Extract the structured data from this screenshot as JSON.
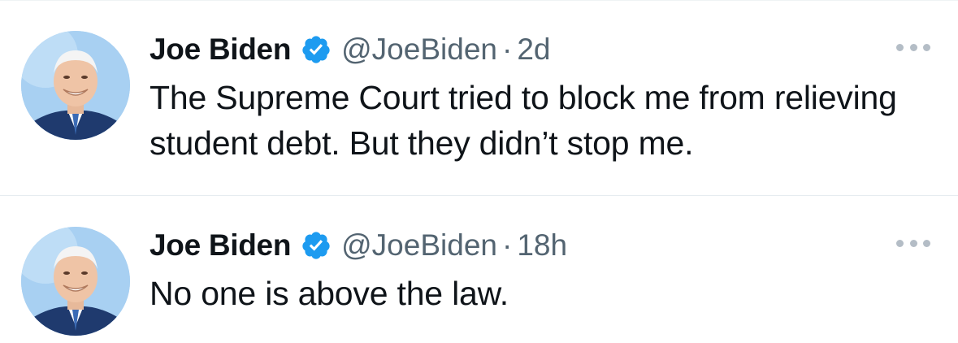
{
  "tweets": [
    {
      "author_name": "Joe Biden",
      "verified_icon": "verified-badge-icon",
      "handle": "@JoeBiden",
      "separator": "·",
      "time": "2d",
      "text": "The Supreme Court tried to block me from relieving student debt. But they didn’t stop me.",
      "more_icon": "more-options-icon"
    },
    {
      "author_name": "Joe Biden",
      "verified_icon": "verified-badge-icon",
      "handle": "@JoeBiden",
      "separator": "·",
      "time": "18h",
      "text": "No one is above the law.",
      "more_icon": "more-options-icon"
    }
  ],
  "colors": {
    "text_primary": "#0f1419",
    "text_secondary": "#536471",
    "verified_blue": "#1d9bf0",
    "divider": "#e6ecf0",
    "more_dots": "#b4bdc6"
  }
}
